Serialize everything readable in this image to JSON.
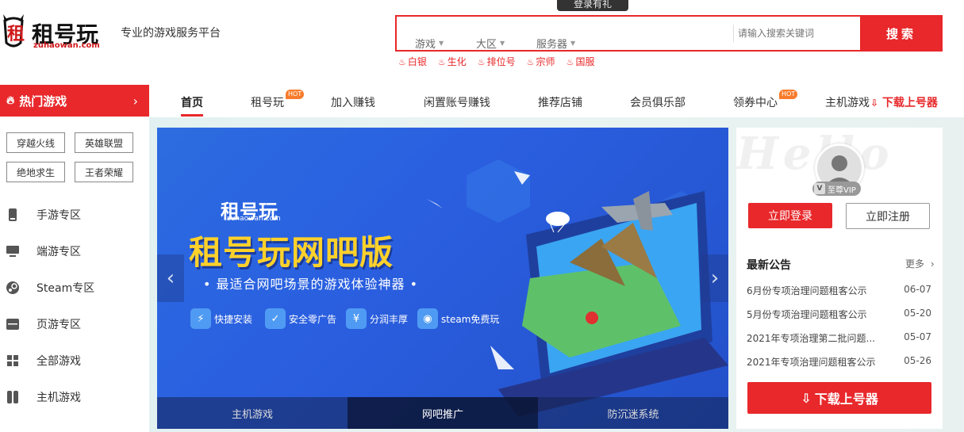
{
  "header": {
    "tooltip": "登录有礼",
    "logo_text": "租号玩",
    "logo_sub": "zuhaowan.com",
    "slogan": "专业的游戏服务平台"
  },
  "search": {
    "select_game": "游戏",
    "select_area": "大区",
    "select_server": "服务器",
    "placeholder": "请输入搜索关键词",
    "button": "搜索"
  },
  "hot_words": [
    "白银",
    "生化",
    "排位号",
    "宗师",
    "国服"
  ],
  "hot_category": {
    "label": "热门游戏"
  },
  "nav": {
    "items": [
      {
        "label": "首页"
      },
      {
        "label": "租号玩",
        "badge": "HOT"
      },
      {
        "label": "加入赚钱"
      },
      {
        "label": "闲置账号赚钱"
      },
      {
        "label": "推荐店铺"
      },
      {
        "label": "会员俱乐部"
      },
      {
        "label": "领券中心",
        "badge": "HOT"
      },
      {
        "label": "主机游戏"
      }
    ],
    "download_label": "下载上号器"
  },
  "sidebar": {
    "tags": [
      "穿越火线",
      "英雄联盟",
      "绝地求生",
      "王者荣耀"
    ],
    "items": [
      {
        "label": "手游专区",
        "icon": "phone-icon"
      },
      {
        "label": "端游专区",
        "icon": "monitor-icon"
      },
      {
        "label": "Steam专区",
        "icon": "steam-icon"
      },
      {
        "label": "页游专区",
        "icon": "browser-icon"
      },
      {
        "label": "全部游戏",
        "icon": "grid-icon"
      },
      {
        "label": "主机游戏",
        "icon": "console-icon"
      }
    ]
  },
  "banner": {
    "logo_text": "租号玩",
    "logo_sub": "zuhaowan.com",
    "title": "租号玩网吧版",
    "subtitle": "• 最适合网吧场景的游戏体验神器 •",
    "features": [
      "快捷安装",
      "安全零广告",
      "分润丰厚",
      "steam免费玩"
    ],
    "tabs": [
      "主机游戏",
      "网吧推广",
      "防沉迷系统"
    ],
    "active_tab": 1
  },
  "user_panel": {
    "hello": "Hello",
    "vip_label": "至尊VIP",
    "login": "立即登录",
    "register": "立即注册"
  },
  "notices": {
    "title": "最新公告",
    "more": "更多",
    "items": [
      {
        "title": "6月份专项治理问题租客公示",
        "date": "06-07"
      },
      {
        "title": "5月份专项治理问题租客公示",
        "date": "05-20"
      },
      {
        "title": "2021年专项治理第二批问题...",
        "date": "05-07"
      },
      {
        "title": "2021年专项治理问题租客公示",
        "date": "05-26"
      }
    ]
  },
  "download_button": "下载上号器",
  "colors": {
    "accent": "#e8282b",
    "banner_blue": "#2a5fe0",
    "title_yellow": "#ffd12a"
  }
}
